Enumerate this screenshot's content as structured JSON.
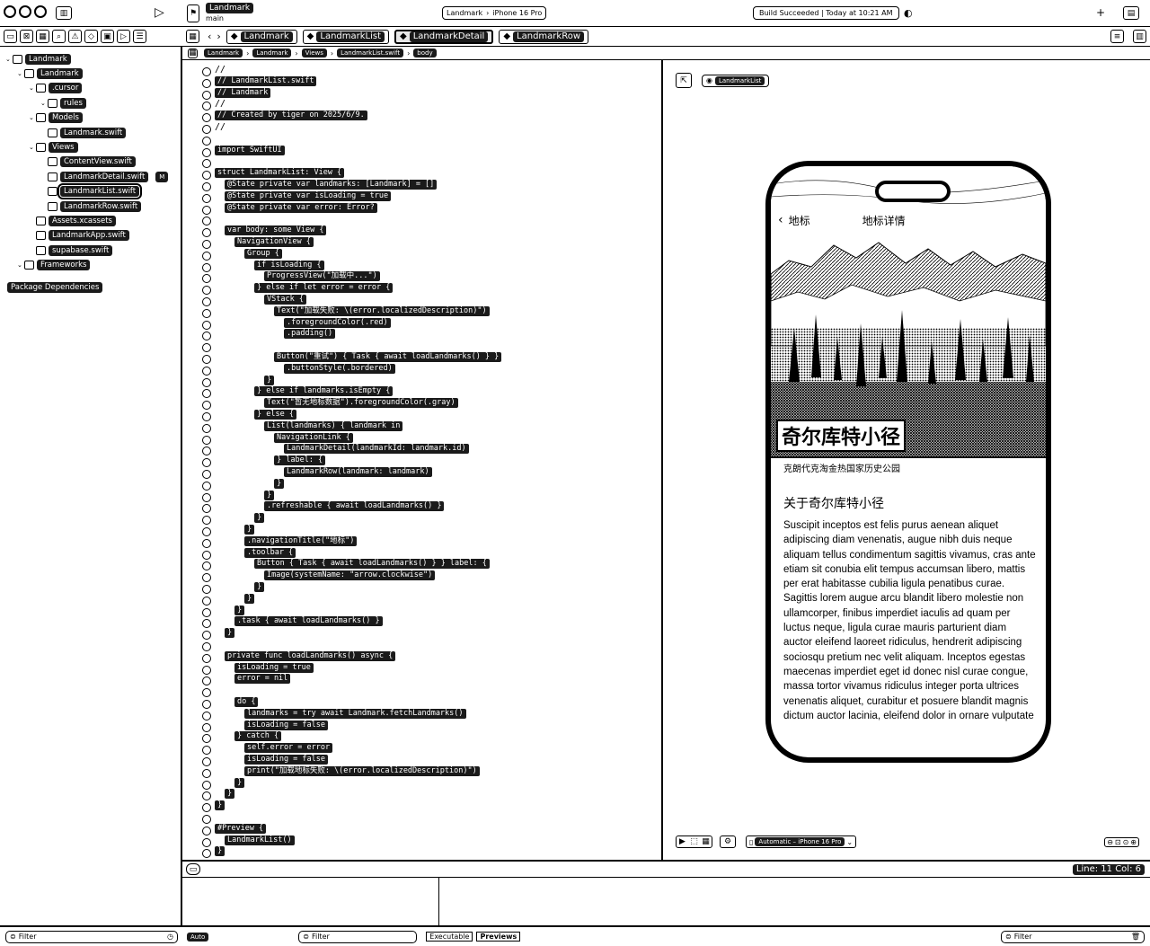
{
  "window": {
    "project_name": "Landmark",
    "branch": "main",
    "scheme": "Landmark",
    "run_destination": "iPhone 16 Pro",
    "status_text": "Build Succeeded | Today at 10:21 AM"
  },
  "tabs": [
    {
      "label": "Landmark"
    },
    {
      "label": "LandmarkList"
    },
    {
      "label": "LandmarkDetail"
    },
    {
      "label": "LandmarkRow"
    }
  ],
  "jumpbar": [
    "Landmark",
    "Landmark",
    "Views",
    "LandmarkList.swift",
    "body"
  ],
  "navigator": {
    "items": [
      {
        "label": "Landmark",
        "depth": 0,
        "kind": "project"
      },
      {
        "label": "Landmark",
        "depth": 1,
        "kind": "folder"
      },
      {
        "label": ".cursor",
        "depth": 2,
        "kind": "folder"
      },
      {
        "label": "rules",
        "depth": 3,
        "kind": "folder"
      },
      {
        "label": "Models",
        "depth": 2,
        "kind": "folder"
      },
      {
        "label": "Landmark.swift",
        "depth": 3,
        "kind": "file"
      },
      {
        "label": "Views",
        "depth": 2,
        "kind": "folder"
      },
      {
        "label": "ContentView.swift",
        "depth": 3,
        "kind": "file"
      },
      {
        "label": "LandmarkDetail.swift",
        "depth": 3,
        "kind": "file",
        "badge": "M"
      },
      {
        "label": "LandmarkList.swift",
        "depth": 3,
        "kind": "file",
        "selected": true
      },
      {
        "label": "LandmarkRow.swift",
        "depth": 3,
        "kind": "file"
      },
      {
        "label": "Assets.xcassets",
        "depth": 2,
        "kind": "file"
      },
      {
        "label": "LandmarkApp.swift",
        "depth": 2,
        "kind": "file"
      },
      {
        "label": "supabase.swift",
        "depth": 2,
        "kind": "file"
      },
      {
        "label": "Frameworks",
        "depth": 1,
        "kind": "folder"
      }
    ],
    "package_dependencies": "Package Dependencies",
    "filter_placeholder": "Filter"
  },
  "code": {
    "lines": [
      {
        "n": 1,
        "indent": 0,
        "text": "//",
        "comment": true
      },
      {
        "n": 2,
        "indent": 0,
        "text": "//  LandmarkList.swift"
      },
      {
        "n": 3,
        "indent": 0,
        "text": "//  Landmark"
      },
      {
        "n": 4,
        "indent": 0,
        "text": "//",
        "comment": true
      },
      {
        "n": 5,
        "indent": 0,
        "text": "//  Created by tiger on 2025/6/9."
      },
      {
        "n": 6,
        "indent": 0,
        "text": "//",
        "comment": true
      },
      {
        "n": 7,
        "indent": 0,
        "text": ""
      },
      {
        "n": 8,
        "indent": 0,
        "text": "import SwiftUI"
      },
      {
        "n": 9,
        "indent": 0,
        "text": ""
      },
      {
        "n": 10,
        "indent": 0,
        "text": "struct LandmarkList: View {"
      },
      {
        "n": 11,
        "indent": 1,
        "text": "@State private var landmarks: [Landmark] = []"
      },
      {
        "n": 12,
        "indent": 1,
        "text": "@State private var isLoading = true"
      },
      {
        "n": 13,
        "indent": 1,
        "text": "@State private var error: Error?"
      },
      {
        "n": 14,
        "indent": 0,
        "text": ""
      },
      {
        "n": 15,
        "indent": 1,
        "text": "var body: some View {"
      },
      {
        "n": 16,
        "indent": 2,
        "text": "NavigationView {"
      },
      {
        "n": 17,
        "indent": 3,
        "text": "Group {"
      },
      {
        "n": 18,
        "indent": 4,
        "text": "if isLoading {"
      },
      {
        "n": 19,
        "indent": 5,
        "text": "ProgressView(\"加载中...\")"
      },
      {
        "n": 20,
        "indent": 4,
        "text": "} else if let error = error {"
      },
      {
        "n": 21,
        "indent": 5,
        "text": "VStack {"
      },
      {
        "n": 22,
        "indent": 6,
        "text": "Text(\"加载失败: \\(error.localizedDescription)\")"
      },
      {
        "n": 23,
        "indent": 7,
        "text": ".foregroundColor(.red)"
      },
      {
        "n": 24,
        "indent": 7,
        "text": ".padding()"
      },
      {
        "n": 25,
        "indent": 0,
        "text": ""
      },
      {
        "n": 26,
        "indent": 6,
        "text": "Button(\"重试\") { Task { await loadLandmarks() } }"
      },
      {
        "n": 27,
        "indent": 7,
        "text": ".buttonStyle(.bordered)"
      },
      {
        "n": 28,
        "indent": 5,
        "text": "}"
      },
      {
        "n": 29,
        "indent": 4,
        "text": "} else if landmarks.isEmpty {"
      },
      {
        "n": 30,
        "indent": 5,
        "text": "Text(\"暂无地标数据\").foregroundColor(.gray)"
      },
      {
        "n": 31,
        "indent": 4,
        "text": "} else {"
      },
      {
        "n": 32,
        "indent": 5,
        "text": "List(landmarks) { landmark in"
      },
      {
        "n": 33,
        "indent": 6,
        "text": "NavigationLink {"
      },
      {
        "n": 34,
        "indent": 7,
        "text": "LandmarkDetail(landmarkId: landmark.id)"
      },
      {
        "n": 35,
        "indent": 6,
        "text": "} label: {"
      },
      {
        "n": 36,
        "indent": 7,
        "text": "LandmarkRow(landmark: landmark)"
      },
      {
        "n": 37,
        "indent": 6,
        "text": "}"
      },
      {
        "n": 38,
        "indent": 5,
        "text": "}"
      },
      {
        "n": 39,
        "indent": 5,
        "text": ".refreshable { await loadLandmarks() }"
      },
      {
        "n": 40,
        "indent": 4,
        "text": "}"
      },
      {
        "n": 41,
        "indent": 3,
        "text": "}"
      },
      {
        "n": 42,
        "indent": 3,
        "text": ".navigationTitle(\"地标\")"
      },
      {
        "n": 43,
        "indent": 3,
        "text": ".toolbar {"
      },
      {
        "n": 44,
        "indent": 4,
        "text": "Button { Task { await loadLandmarks() } } label: {"
      },
      {
        "n": 45,
        "indent": 5,
        "text": "Image(systemName: \"arrow.clockwise\")"
      },
      {
        "n": 46,
        "indent": 4,
        "text": "}"
      },
      {
        "n": 47,
        "indent": 3,
        "text": "}"
      },
      {
        "n": 48,
        "indent": 2,
        "text": "}"
      },
      {
        "n": 49,
        "indent": 2,
        "text": ".task { await loadLandmarks() }"
      },
      {
        "n": 50,
        "indent": 1,
        "text": "}"
      },
      {
        "n": 51,
        "indent": 0,
        "text": ""
      },
      {
        "n": 52,
        "indent": 1,
        "text": "private func loadLandmarks() async {"
      },
      {
        "n": 53,
        "indent": 2,
        "text": "isLoading = true"
      },
      {
        "n": 54,
        "indent": 2,
        "text": "error = nil"
      },
      {
        "n": 55,
        "indent": 0,
        "text": ""
      },
      {
        "n": 56,
        "indent": 2,
        "text": "do {"
      },
      {
        "n": 57,
        "indent": 3,
        "text": "landmarks = try await Landmark.fetchLandmarks()"
      },
      {
        "n": 58,
        "indent": 3,
        "text": "isLoading = false"
      },
      {
        "n": 59,
        "indent": 2,
        "text": "} catch {"
      },
      {
        "n": 60,
        "indent": 3,
        "text": "self.error = error"
      },
      {
        "n": 61,
        "indent": 3,
        "text": "isLoading = false"
      },
      {
        "n": 62,
        "indent": 3,
        "text": "print(\"加载地标失败: \\(error.localizedDescription)\")"
      },
      {
        "n": 63,
        "indent": 2,
        "text": "}"
      },
      {
        "n": 64,
        "indent": 1,
        "text": "}"
      },
      {
        "n": 65,
        "indent": 0,
        "text": "}"
      },
      {
        "n": 66,
        "indent": 0,
        "text": ""
      },
      {
        "n": 67,
        "indent": 0,
        "text": "#Preview {"
      },
      {
        "n": 68,
        "indent": 1,
        "text": "LandmarkList()"
      },
      {
        "n": 69,
        "indent": 0,
        "text": "}"
      }
    ]
  },
  "preview": {
    "pin_label": "LandmarkList",
    "nav_back": "地标",
    "nav_title": "地标详情",
    "landmark_title": "奇尔库特小径",
    "subtitle": "克朗代克淘金热国家历史公园",
    "about_heading": "关于奇尔库特小径",
    "body": "Suscipit inceptos est felis purus aenean aliquet adipiscing diam venenatis, augue nibh duis neque aliquam tellus condimentum sagittis vivamus, cras ante etiam sit conubia elit tempus accumsan libero, mattis per erat habitasse cubilia ligula penatibus curae. Sagittis lorem augue arcu blandit libero molestie non ullamcorper, finibus imperdiet iaculis ad quam per luctus neque, ligula curae mauris parturient diam auctor eleifend laoreet ridiculus, hendrerit adipiscing sociosqu pretium nec velit aliquam. Inceptos egestas maecenas imperdiet eget id donec nisl curae congue, massa tortor vivamus ridiculus integer porta ultrices venenatis aliquet, curabitur et posuere blandit magnis dictum auctor lacinia, eleifend dolor in ornare vulputate",
    "device_label": "Automatic – iPhone 16 Pro"
  },
  "debug": {
    "auto_label": "Auto",
    "filter_placeholder": "Filter",
    "console_tabs": [
      "Executable",
      "Previews"
    ],
    "right_label": "Line: 11  Col: 6"
  },
  "status": {
    "filter_placeholder": "Filter"
  }
}
